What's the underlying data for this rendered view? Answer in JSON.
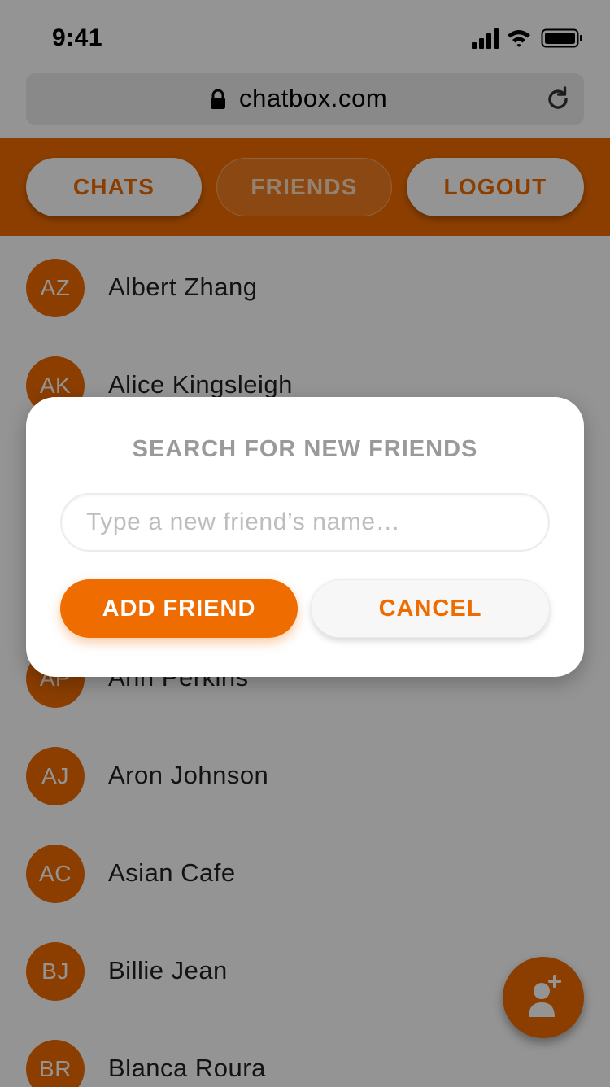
{
  "status_bar": {
    "time": "9:41"
  },
  "browser": {
    "url": "chatbox.com",
    "lock_icon": "lock-icon",
    "reload_icon": "reload-icon"
  },
  "nav": {
    "chats_label": "CHATS",
    "friends_label": "FRIENDS",
    "logout_label": "LOGOUT",
    "active_tab": "FRIENDS"
  },
  "friends": [
    {
      "initials": "AZ",
      "name": "Albert Zhang"
    },
    {
      "initials": "AK",
      "name": "Alice Kingsleigh"
    },
    {
      "initials": "",
      "name": ""
    },
    {
      "initials": "",
      "name": ""
    },
    {
      "initials": "AP",
      "name": "Ann Perkins"
    },
    {
      "initials": "AJ",
      "name": "Aron Johnson"
    },
    {
      "initials": "AC",
      "name": "Asian Cafe"
    },
    {
      "initials": "BJ",
      "name": "Billie Jean"
    },
    {
      "initials": "BR",
      "name": "Blanca Roura"
    }
  ],
  "modal": {
    "title": "SEARCH FOR NEW FRIENDS",
    "input_placeholder": "Type a new friend’s name…",
    "input_value": "",
    "add_label": "ADD FRIEND",
    "cancel_label": "CANCEL"
  },
  "fab": {
    "icon": "add-user-icon"
  },
  "colors": {
    "accent": "#ef6c00",
    "overlay": "rgba(0,0,0,0.42)"
  }
}
